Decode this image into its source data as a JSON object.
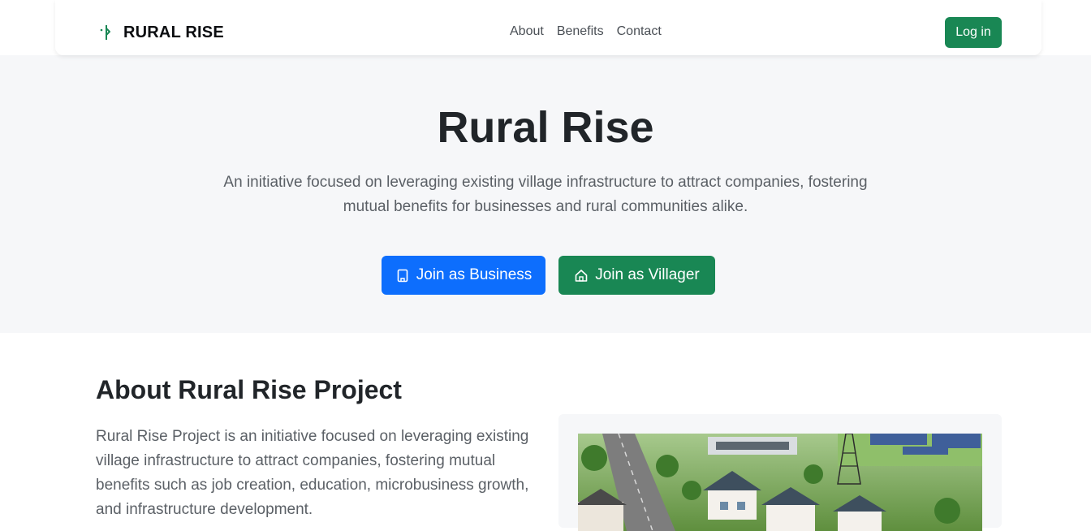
{
  "navbar": {
    "brand_text": "RURAL RISE",
    "brand_icon": "signpost-split-icon",
    "links": [
      {
        "label": "About"
      },
      {
        "label": "Benefits"
      },
      {
        "label": "Contact"
      }
    ],
    "login_label": "Log in"
  },
  "hero": {
    "title": "Rural Rise",
    "subtitle": "An initiative focused on leveraging existing village infrastructure to attract companies, fostering mutual benefits for businesses and rural communities alike.",
    "buttons": [
      {
        "label": "Join as Business",
        "icon": "building-icon"
      },
      {
        "label": "Join as Villager",
        "icon": "house-icon"
      }
    ]
  },
  "about": {
    "title": "About Rural Rise Project",
    "text": "Rural Rise Project is an initiative focused on leveraging existing village infrastructure to attract companies, fostering mutual benefits such as job creation, education, microbusiness growth, and infrastructure development."
  },
  "colors": {
    "primary_blue": "#0d6efd",
    "success_green": "#198754",
    "hero_bg": "#f6f7f9",
    "text_dark": "#212529",
    "text_muted": "#5b6066"
  }
}
